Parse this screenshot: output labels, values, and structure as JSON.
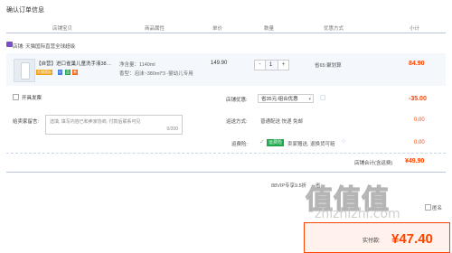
{
  "page": {
    "title": "确认订单信息"
  },
  "columns": {
    "shop": "店铺宝贝",
    "attrs": "商品属性",
    "price": "单价",
    "qty": "数量",
    "promo": "优惠方式",
    "subtotal": "小计"
  },
  "store": {
    "label": "店铺:",
    "name": "天猫国际直营全球超级"
  },
  "item": {
    "title": "【自营】进口雀巢儿童洗手液38…",
    "tags": [
      "天猫国际",
      "V",
      "品",
      "券"
    ],
    "attr1": "净含量：1140ml",
    "attr2": "香型：泡沫~380ml*3 -婴幼儿专用",
    "price": "149.90",
    "qty_minus": "-",
    "qty_value": "1",
    "qty_plus": "+",
    "promo": "省65:聚划算",
    "subtotal": "84.90"
  },
  "options": {
    "invoice_label": "开具发票",
    "message_label": "给卖家留言:",
    "message_placeholder": "选填, 填写内容已和卖家协商, 付款后联系可见",
    "message_count": "0/200"
  },
  "summary": {
    "store_promo_label": "店铺优惠:",
    "store_promo_value": "省35元:组合优惠",
    "store_promo_amount": "-35.00",
    "shipping_label": "运送方式:",
    "shipping_value": "普通配送 快递 免邮",
    "shipping_amount": "0.00",
    "insurance_label": "运费险:",
    "insurance_badge": "运费险",
    "insurance_text": "卖家赠送, 退换货可赔",
    "insurance_amount": "0.00",
    "total_label": "店铺合计(含运费)",
    "total_amount": "¥49.90"
  },
  "vip": {
    "text": "88VIP专享9.5折",
    "extra": "省"
  },
  "bottom": {
    "pay_label": "实付款:",
    "pay_amount": "¥47.40",
    "partial": "匿名"
  },
  "watermark": {
    "logo": "值值值",
    "url": "zhizhizhi.com"
  },
  "colors": {
    "accent": "#ff4400",
    "border": "#b8c3dd",
    "green": "#1fa84a"
  }
}
